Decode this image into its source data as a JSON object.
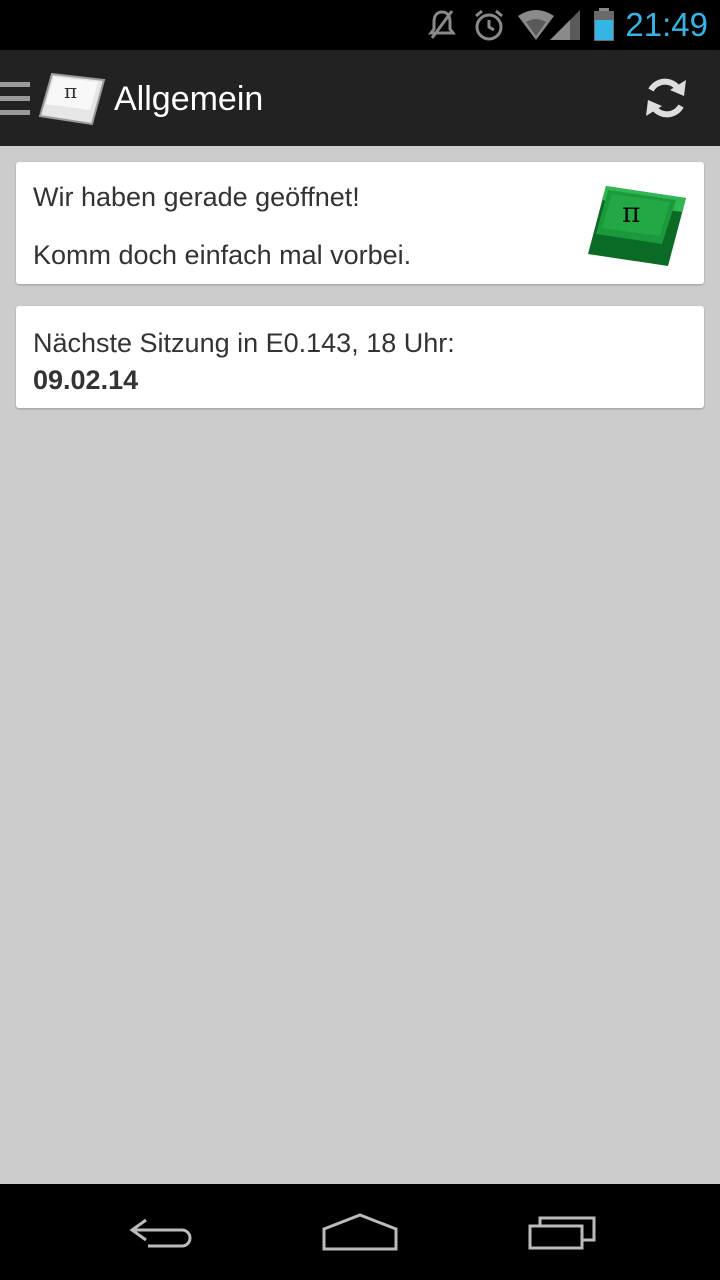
{
  "status_bar": {
    "time": "21:49",
    "icons": [
      "mute-icon",
      "alarm-icon",
      "wifi-icon",
      "signal-icon",
      "battery-icon"
    ],
    "accent_color": "#33b5e5"
  },
  "action_bar": {
    "title": "Allgemein",
    "icons": [
      "drawer-menu-icon",
      "app-logo-icon",
      "refresh-icon"
    ]
  },
  "cards": {
    "open_card": {
      "line1": "Wir haben gerade geöffnet!",
      "line2": "Komm doch einfach mal vorbei.",
      "logo_color": "#1a9a3c"
    },
    "session_card": {
      "line1": "Nächste Sitzung in E0.143, 18 Uhr:",
      "date": "09.02.14"
    }
  },
  "nav_bar": {
    "buttons": [
      "back-icon",
      "home-icon",
      "recent-apps-icon"
    ]
  }
}
